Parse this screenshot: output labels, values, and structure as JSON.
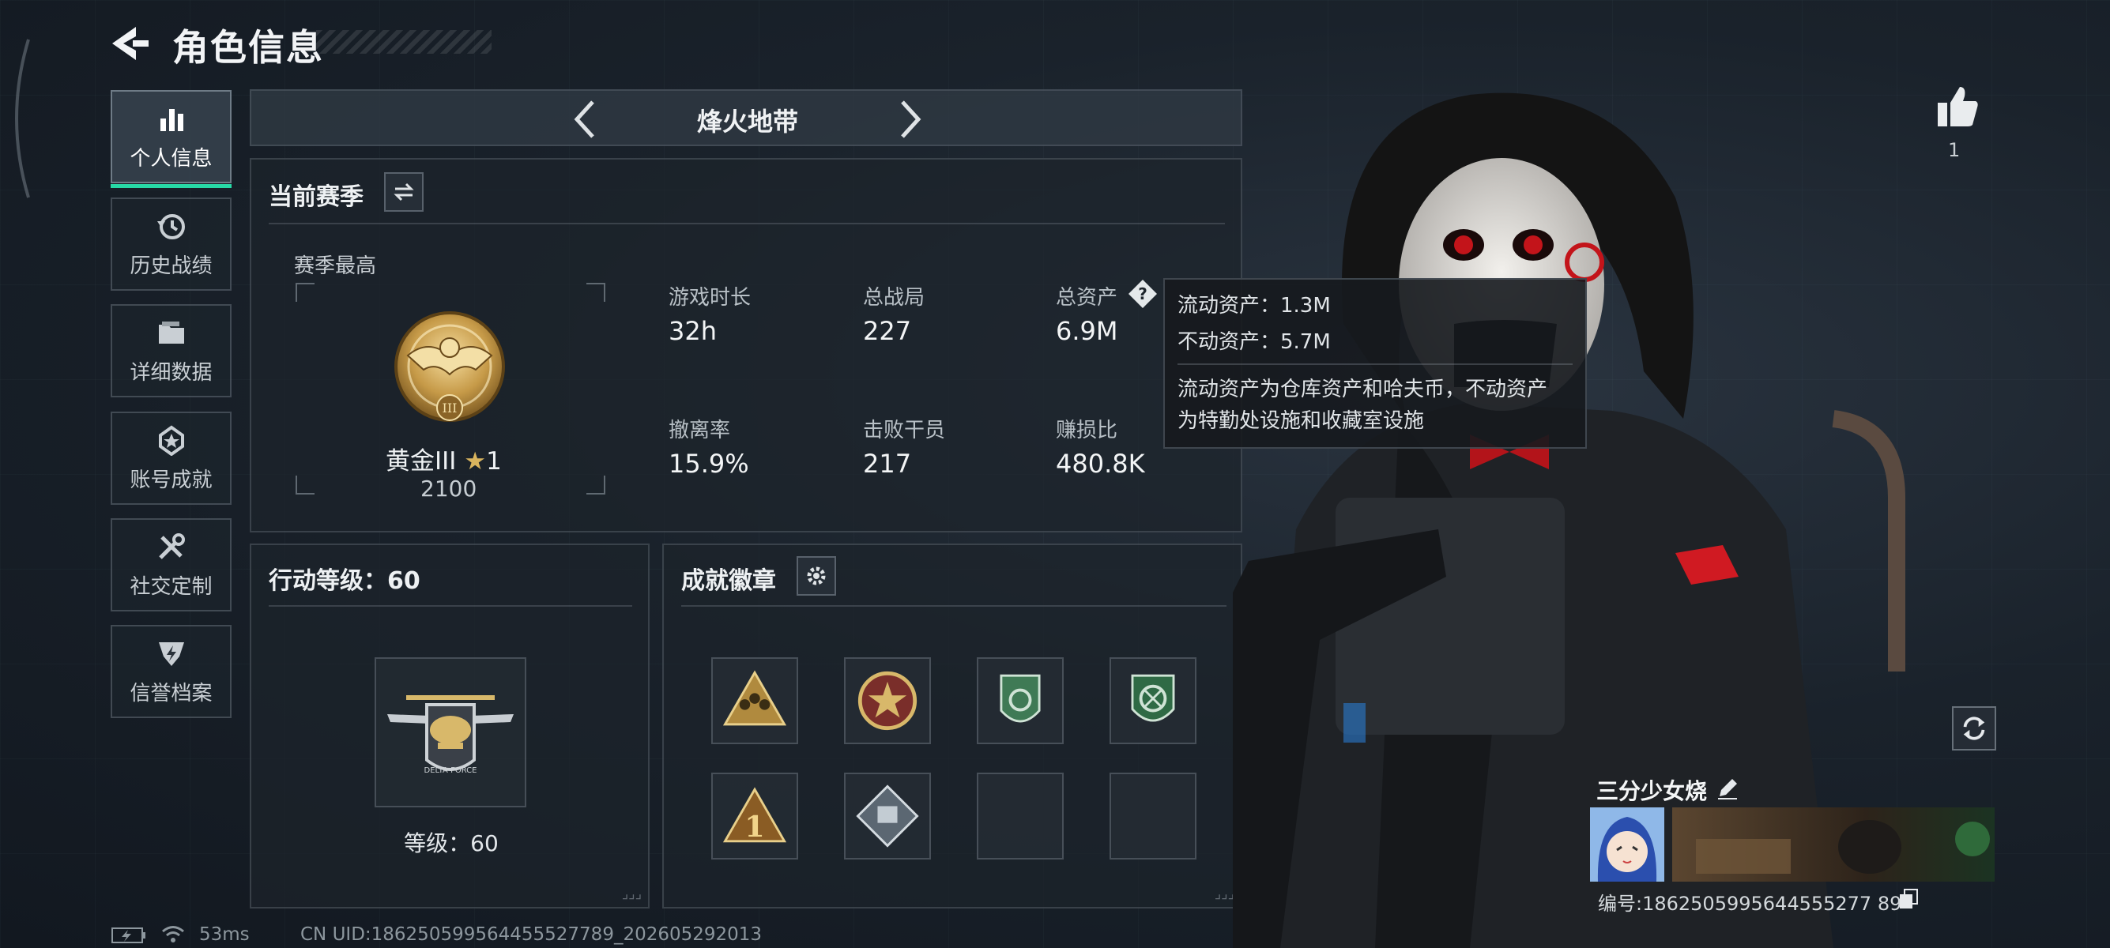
{
  "header": {
    "title": "角色信息"
  },
  "nav": {
    "items": [
      {
        "label": "个人信息",
        "icon": "bar-chart-icon",
        "active": true
      },
      {
        "label": "历史战绩",
        "icon": "history-icon",
        "active": false
      },
      {
        "label": "详细数据",
        "icon": "folder-icon",
        "active": false
      },
      {
        "label": "账号成就",
        "icon": "achievement-icon",
        "active": false
      },
      {
        "label": "社交定制",
        "icon": "tools-icon",
        "active": false
      },
      {
        "label": "信誉档案",
        "icon": "shield-bolt-icon",
        "active": false
      }
    ]
  },
  "mode": {
    "title": "烽火地带"
  },
  "season": {
    "title": "当前赛季",
    "best_label": "赛季最高",
    "rank_name": "黄金III",
    "rank_stars": "1",
    "rank_points": "2100",
    "stats": [
      {
        "label": "游戏时长",
        "value": "32h"
      },
      {
        "label": "总战局",
        "value": "227"
      },
      {
        "label": "总资产",
        "value": "6.9M"
      },
      {
        "label": "撤离率",
        "value": "15.9%"
      },
      {
        "label": "击败干员",
        "value": "217"
      },
      {
        "label": "赚损比",
        "value": "480.8K"
      }
    ]
  },
  "tooltip": {
    "liquid": "流动资产：1.3M",
    "fixed": "不动资产：5.7M",
    "desc_line1": "流动资产为仓库资产和哈夫币，不动资产",
    "desc_line2": "为特勤处设施和收藏室设施"
  },
  "action_level": {
    "title": "行动等级：60",
    "level_text": "等级：60"
  },
  "achievements": {
    "title": "成就徽章",
    "slots_filled": 6,
    "slots_total": 8
  },
  "player": {
    "likes": "1",
    "name": "三分少女烧",
    "id": "编号:1862505995644555277 89"
  },
  "status": {
    "ping": "53ms",
    "uid": "CN UID:186250599564455527789_202605292013"
  },
  "colors": {
    "accent": "#27d9a6",
    "gold": "#c9a24a",
    "green_badge": "#3f7a55"
  }
}
